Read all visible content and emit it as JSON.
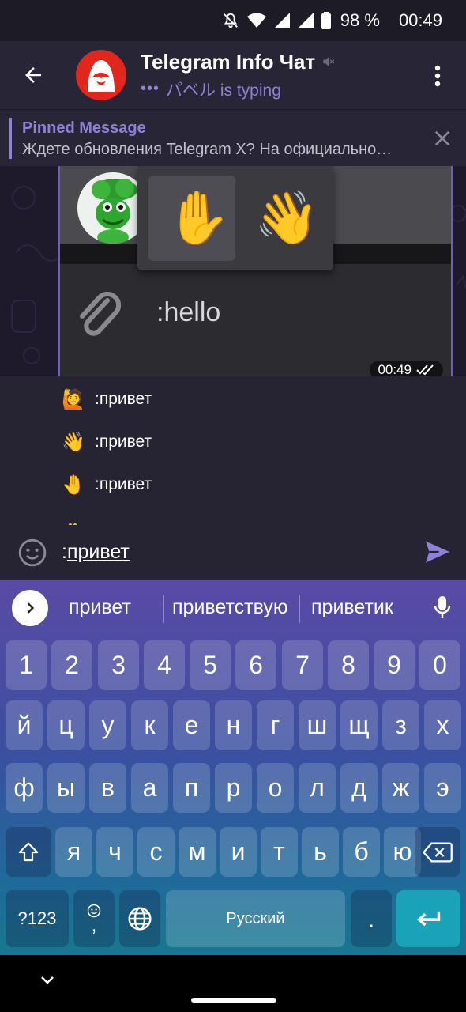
{
  "status_bar": {
    "battery": "98 %",
    "time": "00:49",
    "icons": [
      "mute-icon",
      "wifi-icon",
      "signal-icon",
      "signal-icon",
      "battery-icon"
    ]
  },
  "header": {
    "title": "Telegram Info Чат",
    "typing": "パベル is typing",
    "icons": [
      "back-arrow-icon",
      "muted-speaker-icon",
      "more-vert-icon"
    ]
  },
  "pinned": {
    "title": "Pinned Message",
    "text": "Ждете обновления Telegram X?  На официально…"
  },
  "message": {
    "hello_text": ":hello",
    "time": "00:49",
    "emojis": [
      "✋",
      "👋"
    ]
  },
  "suggestions": [
    {
      "emoji": "🙋",
      "text": ":привет"
    },
    {
      "emoji": "👋",
      "text": ":привет"
    },
    {
      "emoji": "🤚",
      "text": ":привет"
    }
  ],
  "input": {
    "prefix": ":",
    "value": "привет"
  },
  "keyboard": {
    "suggestions": [
      "привет",
      "приветствую",
      "приветик"
    ],
    "row_numbers": [
      "1",
      "2",
      "3",
      "4",
      "5",
      "6",
      "7",
      "8",
      "9",
      "0"
    ],
    "row1": [
      "й",
      "ц",
      "у",
      "к",
      "е",
      "н",
      "г",
      "ш",
      "щ",
      "з",
      "х"
    ],
    "row2": [
      "ф",
      "ы",
      "в",
      "а",
      "п",
      "р",
      "о",
      "л",
      "д",
      "ж",
      "э"
    ],
    "row3": [
      "я",
      "ч",
      "с",
      "м",
      "и",
      "т",
      "ь",
      "б",
      "ю"
    ],
    "symbols_key": "?123",
    "emoji_comma_key": ",",
    "space_label": "Русский",
    "period_key": "."
  },
  "colors": {
    "accent": "#8f82d6",
    "header_bg": "#272536",
    "enter_key": "#1aa3b8"
  }
}
